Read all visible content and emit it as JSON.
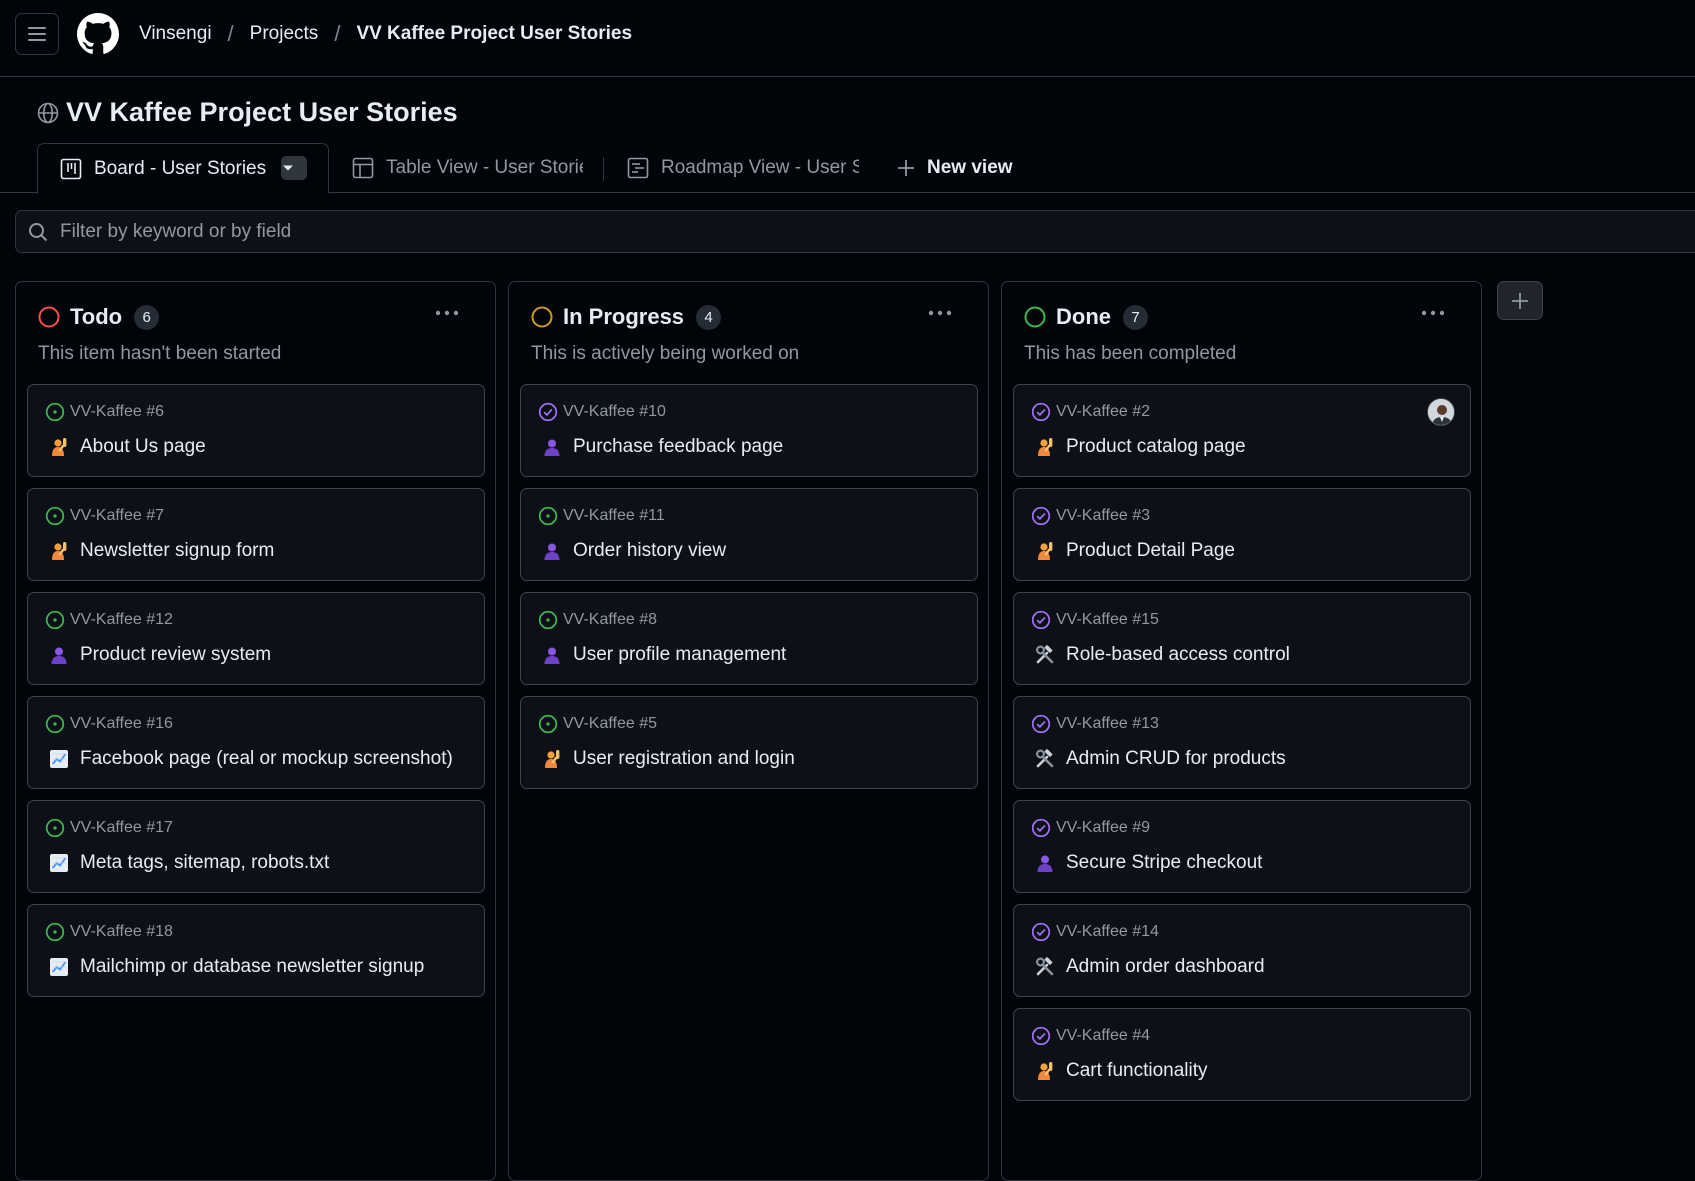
{
  "breadcrumb": [
    "Vinsengi",
    "Projects",
    "VV Kaffee Project User Stories"
  ],
  "project": {
    "title": "VV Kaffee Project User Stories"
  },
  "tabs": [
    {
      "label": "Board - User Stories",
      "active": true
    },
    {
      "label": "Table View - User Stories"
    },
    {
      "label": "Roadmap View - User Stories"
    }
  ],
  "new_view_label": "New view",
  "filter": {
    "placeholder": "Filter by keyword or by field"
  },
  "colors": {
    "todo": "#f85149",
    "in_progress": "#d29922",
    "done": "#3fb950",
    "open_issue": "#3fb950",
    "closed_issue": "#a371f7"
  },
  "columns": [
    {
      "name": "Todo",
      "count": "6",
      "description": "This item hasn't been started",
      "status_color": "#f85149",
      "cards": [
        {
          "ref": "VV-Kaffee #6",
          "title": "About Us page",
          "icon": "raising-hand-icon",
          "state": "open"
        },
        {
          "ref": "VV-Kaffee #7",
          "title": "Newsletter signup form",
          "icon": "raising-hand-icon",
          "state": "open"
        },
        {
          "ref": "VV-Kaffee #12",
          "title": "Product review system",
          "icon": "user-silhouette-icon",
          "state": "open"
        },
        {
          "ref": "VV-Kaffee #16",
          "title": "Facebook page (real or mockup screenshot)",
          "icon": "chart-increasing-icon",
          "state": "open"
        },
        {
          "ref": "VV-Kaffee #17",
          "title": "Meta tags, sitemap, robots.txt",
          "icon": "chart-increasing-icon",
          "state": "open"
        },
        {
          "ref": "VV-Kaffee #18",
          "title": "Mailchimp or database newsletter signup",
          "icon": "chart-increasing-icon",
          "state": "open"
        }
      ]
    },
    {
      "name": "In Progress",
      "count": "4",
      "description": "This is actively being worked on",
      "status_color": "#d29922",
      "cards": [
        {
          "ref": "VV-Kaffee #10",
          "title": "Purchase feedback page",
          "icon": "user-silhouette-icon",
          "state": "closed"
        },
        {
          "ref": "VV-Kaffee #11",
          "title": "Order history view",
          "icon": "user-silhouette-icon",
          "state": "open"
        },
        {
          "ref": "VV-Kaffee #8",
          "title": "User profile management",
          "icon": "user-silhouette-icon",
          "state": "open"
        },
        {
          "ref": "VV-Kaffee #5",
          "title": "User registration and login",
          "icon": "raising-hand-icon",
          "state": "open"
        }
      ]
    },
    {
      "name": "Done",
      "count": "7",
      "description": "This has been completed",
      "status_color": "#3fb950",
      "cards": [
        {
          "ref": "VV-Kaffee #2",
          "title": "Product catalog page",
          "icon": "raising-hand-icon",
          "state": "closed",
          "avatar": true
        },
        {
          "ref": "VV-Kaffee #3",
          "title": "Product Detail Page",
          "icon": "raising-hand-icon",
          "state": "closed"
        },
        {
          "ref": "VV-Kaffee #15",
          "title": "Role-based access control",
          "icon": "hammer-wrench-icon",
          "state": "closed"
        },
        {
          "ref": "VV-Kaffee #13",
          "title": "Admin CRUD for products",
          "icon": "hammer-wrench-icon",
          "state": "closed"
        },
        {
          "ref": "VV-Kaffee #9",
          "title": "Secure Stripe checkout",
          "icon": "user-silhouette-icon",
          "state": "closed"
        },
        {
          "ref": "VV-Kaffee #14",
          "title": "Admin order dashboard",
          "icon": "hammer-wrench-icon",
          "state": "closed"
        },
        {
          "ref": "VV-Kaffee #4",
          "title": "Cart functionality",
          "icon": "raising-hand-icon",
          "state": "closed"
        }
      ]
    }
  ]
}
